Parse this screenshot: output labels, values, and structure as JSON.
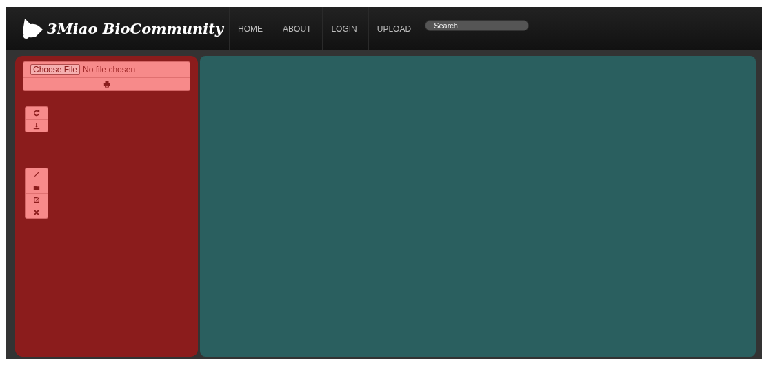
{
  "header": {
    "logo": "3Miao BioCommunity",
    "nav": [
      {
        "label": "HOME"
      },
      {
        "label": "ABOUT"
      },
      {
        "label": "LOGIN"
      },
      {
        "label": "UPLOAD"
      }
    ],
    "search": {
      "placeholder": "Search"
    }
  },
  "upload": {
    "button": "Choose File",
    "status": "No file chosen"
  }
}
